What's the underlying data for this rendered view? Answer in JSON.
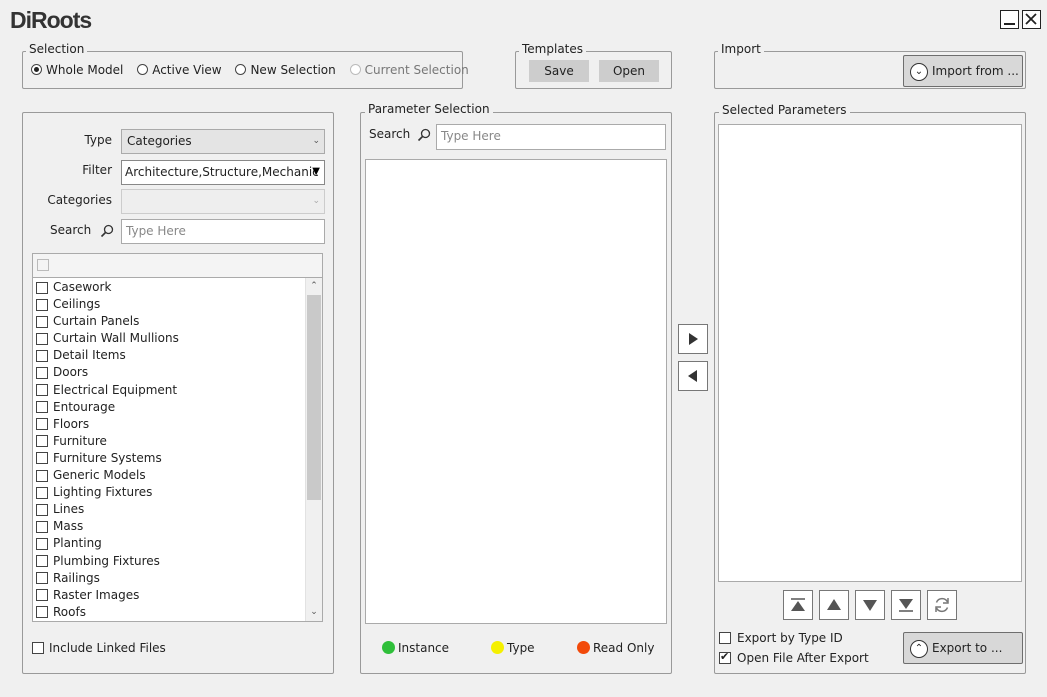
{
  "app": {
    "logo": "DiRoots"
  },
  "colors": {
    "instance": "#2fbf3a",
    "type": "#f5f000",
    "read_only": "#f24a0a"
  },
  "selection": {
    "legend": "Selection",
    "options": [
      {
        "label": "Whole Model",
        "selected": true,
        "enabled": true
      },
      {
        "label": "Active View",
        "selected": false,
        "enabled": true
      },
      {
        "label": "New Selection",
        "selected": false,
        "enabled": true
      },
      {
        "label": "Current Selection",
        "selected": false,
        "enabled": false
      }
    ]
  },
  "templates": {
    "legend": "Templates",
    "save": "Save",
    "open": "Open"
  },
  "import": {
    "legend": "Import",
    "button": "Import from ..."
  },
  "left": {
    "type_label": "Type",
    "type_value": "Categories",
    "filter_label": "Filter",
    "filter_value": "Architecture,Structure,Mechanic",
    "categories_label": "Categories",
    "categories_value": "",
    "search_label": "Search",
    "search_placeholder": "Type Here",
    "items": [
      "Casework",
      "Ceilings",
      "Curtain Panels",
      "Curtain Wall Mullions",
      "Detail Items",
      "Doors",
      "Electrical Equipment",
      "Entourage",
      "Floors",
      "Furniture",
      "Furniture Systems",
      "Generic Models",
      "Lighting Fixtures",
      "Lines",
      "Mass",
      "Planting",
      "Plumbing Fixtures",
      "Railings",
      "Raster Images",
      "Roofs"
    ],
    "include_linked": "Include Linked Files"
  },
  "param": {
    "legend": "Parameter Selection",
    "search_label": "Search",
    "search_placeholder": "Type Here",
    "legend_instance": "Instance",
    "legend_type": "Type",
    "legend_readonly": "Read Only"
  },
  "selected": {
    "legend": "Selected Parameters",
    "export_by_type_id": "Export by Type ID",
    "open_after_export": "Open File After Export",
    "export_button": "Export to ..."
  }
}
